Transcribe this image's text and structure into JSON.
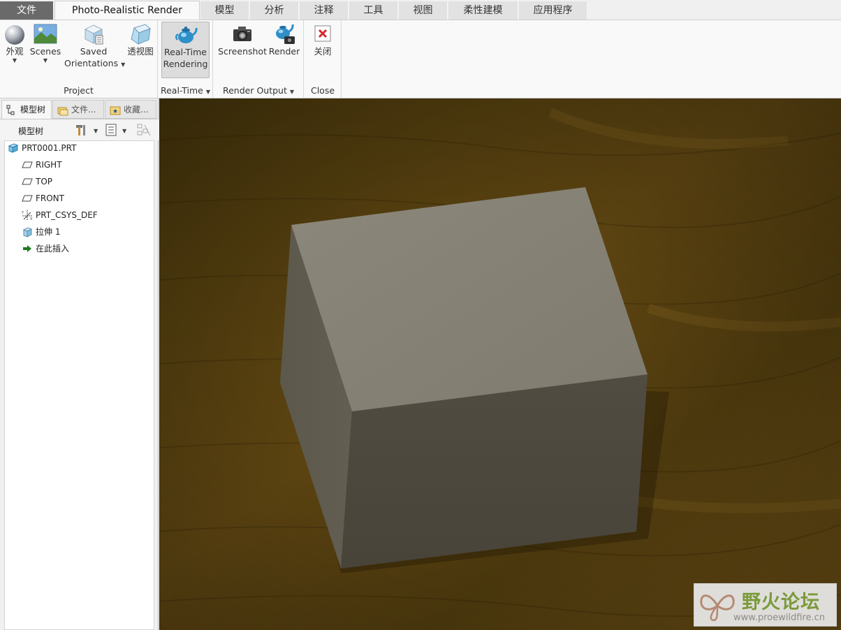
{
  "tabs": [
    {
      "label": "文件"
    },
    {
      "label": "Photo-Realistic Render"
    },
    {
      "label": "模型"
    },
    {
      "label": "分析"
    },
    {
      "label": "注释"
    },
    {
      "label": "工具"
    },
    {
      "label": "视图"
    },
    {
      "label": "柔性建模"
    },
    {
      "label": "应用程序"
    }
  ],
  "ribbon": {
    "project": {
      "label": "Project",
      "appearance": "外观",
      "scenes": "Scenes",
      "saved_line1": "Saved",
      "saved_line2": "Orientations",
      "perspective": "透视图"
    },
    "realtime": {
      "label": "Real-Time",
      "btn_line1": "Real-Time",
      "btn_line2": "Rendering"
    },
    "output": {
      "label": "Render Output",
      "screenshot": "Screenshot",
      "render": "Render"
    },
    "close": {
      "label": "Close",
      "btn": "关闭"
    }
  },
  "panel": {
    "tabs": [
      {
        "label": "模型树"
      },
      {
        "label": "文件..."
      },
      {
        "label": "收藏..."
      }
    ],
    "tree_title": "模型树",
    "tree": [
      {
        "label": "PRT0001.PRT",
        "icon": "part-icon"
      },
      {
        "label": "RIGHT",
        "icon": "datum-plane-icon"
      },
      {
        "label": "TOP",
        "icon": "datum-plane-icon"
      },
      {
        "label": "FRONT",
        "icon": "datum-plane-icon"
      },
      {
        "label": "PRT_CSYS_DEF",
        "icon": "csys-icon"
      },
      {
        "label": "拉伸 1",
        "icon": "extrude-icon"
      },
      {
        "label": "在此插入",
        "icon": "insert-here-icon"
      }
    ]
  },
  "watermark": {
    "title": "野火论坛",
    "url": "www.proewildfire.cn"
  },
  "colors": {
    "file_tab": "#6a6a6a",
    "wood_dark": "#4a3508",
    "wood_light": "#7a5a18",
    "cube_top": "#858175",
    "cube_front": "#4e4a40",
    "cube_side": "#5e5a4e",
    "watermark_green": "#7a9a3a"
  }
}
